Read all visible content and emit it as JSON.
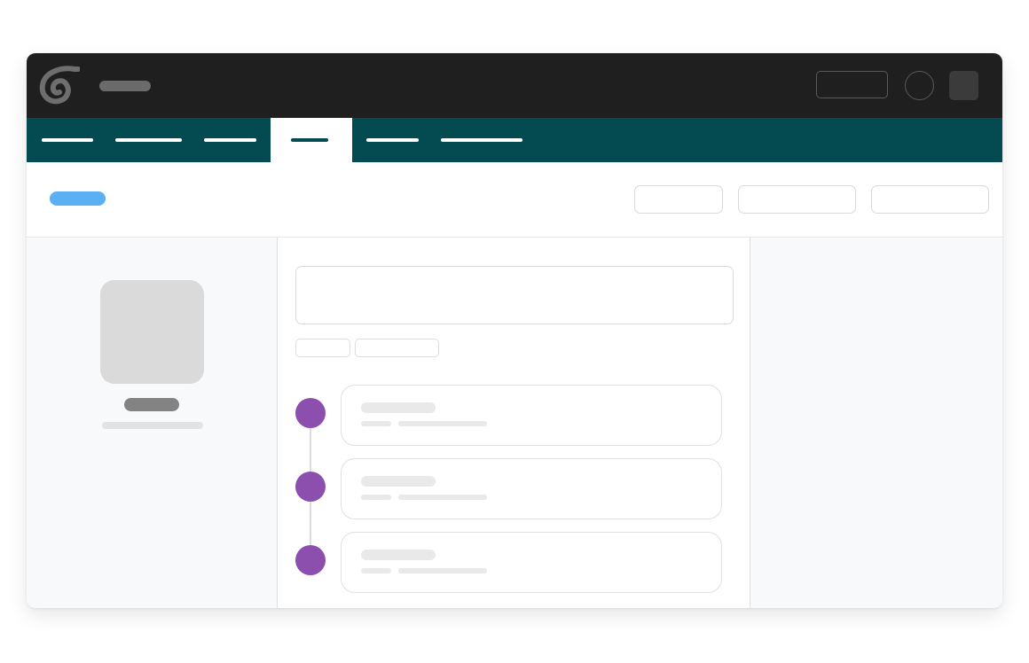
{
  "colors": {
    "header_background": "#1f1f1f",
    "nav_background": "#034b51",
    "accent_link": "#5ab0f2",
    "timeline_dot": "#8d4fae",
    "placeholder_fill": "#dadada",
    "panel_background": "#f8f9fb"
  },
  "header": {
    "logo_icon": "spiral-logo-icon",
    "title": "",
    "action_button_label": "",
    "avatar_icon": "user-avatar-icon",
    "menu_icon": "square-menu-icon"
  },
  "nav": {
    "active_index": 3,
    "tabs": [
      {
        "label": ""
      },
      {
        "label": ""
      },
      {
        "label": ""
      },
      {
        "label": ""
      },
      {
        "label": ""
      },
      {
        "label": ""
      }
    ]
  },
  "toolbar": {
    "link_label": "",
    "buttons": [
      {
        "label": ""
      },
      {
        "label": ""
      },
      {
        "label": ""
      }
    ]
  },
  "profile": {
    "image_icon": "profile-image-placeholder",
    "name": "",
    "subtitle": ""
  },
  "composer": {
    "placeholder": "",
    "chips": [
      {
        "label": ""
      },
      {
        "label": ""
      }
    ]
  },
  "timeline": {
    "items": [
      {
        "title": "",
        "meta": "",
        "detail": ""
      },
      {
        "title": "",
        "meta": "",
        "detail": ""
      },
      {
        "title": "",
        "meta": "",
        "detail": ""
      }
    ]
  }
}
